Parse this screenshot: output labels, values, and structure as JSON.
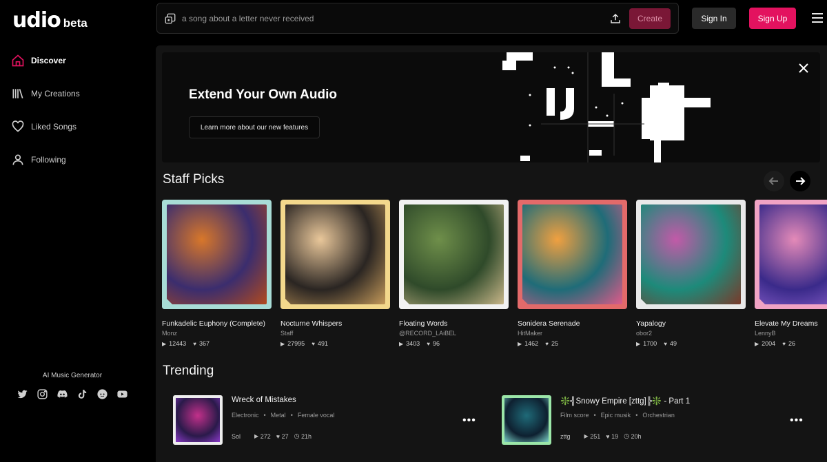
{
  "app": {
    "logo_text": "udio",
    "logo_suffix": "beta"
  },
  "sidebar": {
    "items": [
      {
        "label": "Discover",
        "icon": "home-icon",
        "active": true
      },
      {
        "label": "My Creations",
        "icon": "library-icon"
      },
      {
        "label": "Liked Songs",
        "icon": "heart-icon"
      },
      {
        "label": "Following",
        "icon": "user-icon"
      }
    ],
    "footer_caption": "AI Music Generator",
    "socials": [
      "twitter-icon",
      "instagram-icon",
      "discord-icon",
      "tiktok-icon",
      "reddit-icon",
      "youtube-icon"
    ]
  },
  "search": {
    "placeholder": "a song about a letter never received",
    "create_label": "Create"
  },
  "header": {
    "signin_label": "Sign In",
    "signup_label": "Sign Up"
  },
  "banner": {
    "title": "Extend Your Own Audio",
    "button_label": "Learn more about our new features"
  },
  "staff_picks": {
    "title": "Staff Picks",
    "cards": [
      {
        "title": "Funkadelic Euphony (Complete)",
        "artist": "Monz",
        "plays": "12443",
        "likes": "367",
        "frame": "#a8dcd6",
        "colors": [
          "#d8772a",
          "#3b2d6e",
          "#b24a1e"
        ]
      },
      {
        "title": "Nocturne Whispers",
        "artist": "Staff",
        "plays": "27995",
        "likes": "491",
        "frame": "#f3d88c",
        "colors": [
          "#e9c79a",
          "#2a2522",
          "#c59a5a"
        ]
      },
      {
        "title": "Floating Words",
        "artist": "@RECORD_LAiBEL",
        "plays": "3403",
        "likes": "96",
        "frame": "#f2f2f2",
        "colors": [
          "#6f8f4a",
          "#2f4a2a",
          "#c9b78a"
        ]
      },
      {
        "title": "Sonidera Serenade",
        "artist": "HitMaker",
        "plays": "1462",
        "likes": "25",
        "frame": "#e36a6a",
        "colors": [
          "#f0a040",
          "#1f6c78",
          "#e05a8a"
        ]
      },
      {
        "title": "Yapalogy",
        "artist": "obor2",
        "plays": "1700",
        "likes": "49",
        "frame": "#e9e9e9",
        "colors": [
          "#c25aa8",
          "#1d8a7a",
          "#7a3a2a"
        ]
      },
      {
        "title": "Elevate My Dreams",
        "artist": "LennyB",
        "plays": "2004",
        "likes": "26",
        "frame": "#f1a3c4",
        "colors": [
          "#e48ab8",
          "#3a2a8a",
          "#9a6ad8"
        ]
      }
    ]
  },
  "trending": {
    "title": "Trending",
    "items": [
      {
        "title": "Wreck of Mistakes",
        "tags": [
          "Electronic",
          "Metal",
          "Female vocal"
        ],
        "artist": "Sol",
        "plays": "272",
        "likes": "27",
        "age": "21h",
        "frame": "#eeeeee",
        "colors": [
          "#c2308a",
          "#2a1a4a",
          "#8a3ac8"
        ]
      },
      {
        "title": "❇️╣Snowy Empire [zttg]╠❇️ - Part 1",
        "tags": [
          "Film score",
          "Epic musik",
          "Orchestrian"
        ],
        "artist": "zttg",
        "plays": "251",
        "likes": "19",
        "age": "20h",
        "frame": "#9be6a8",
        "colors": [
          "#1f6a78",
          "#0e2030",
          "#7ad0c8"
        ]
      }
    ]
  }
}
